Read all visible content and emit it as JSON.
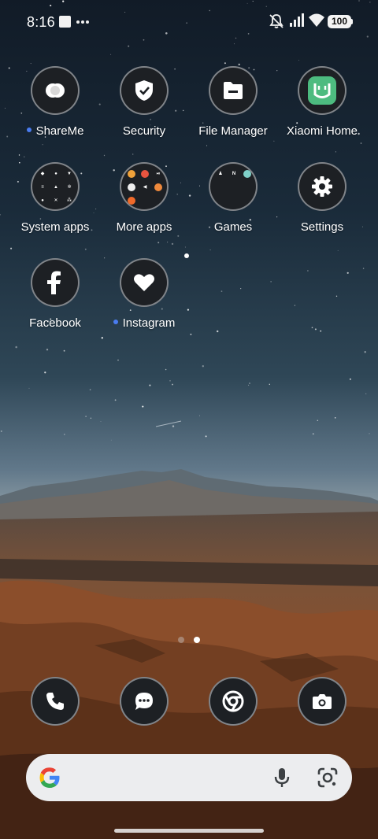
{
  "status_bar": {
    "time": "8:16",
    "battery": "100",
    "icons": [
      "media-square-icon",
      "more-notifications-icon",
      "silent-mode-icon",
      "signal-icon",
      "wifi-icon",
      "battery-icon"
    ]
  },
  "apps": [
    {
      "label": "ShareMe",
      "icon": "shareme-icon",
      "new_dot": true
    },
    {
      "label": "Security",
      "icon": "shield-check-icon",
      "new_dot": false
    },
    {
      "label": "File Manager",
      "icon": "folder-icon",
      "new_dot": false
    },
    {
      "label": "Xiaomi Home",
      "icon": "mi-home-icon",
      "new_dot": false
    },
    {
      "label": "System apps",
      "icon": "folder-system-apps-icon",
      "new_dot": false
    },
    {
      "label": "More apps",
      "icon": "folder-more-apps-icon",
      "new_dot": false
    },
    {
      "label": "Games",
      "icon": "folder-games-icon",
      "new_dot": false
    },
    {
      "label": "Settings",
      "icon": "gear-icon",
      "new_dot": false
    },
    {
      "label": "Facebook",
      "icon": "facebook-icon",
      "new_dot": false
    },
    {
      "label": "Instagram",
      "icon": "heart-icon",
      "new_dot": true
    }
  ],
  "page_indicator": {
    "pages": 2,
    "current": 2
  },
  "dock": [
    {
      "icon": "phone-icon"
    },
    {
      "icon": "messages-icon"
    },
    {
      "icon": "chrome-icon"
    },
    {
      "icon": "camera-icon"
    }
  ],
  "search_bar": {
    "logo": "google-g-icon",
    "voice": "microphone-icon",
    "lens": "google-lens-icon"
  },
  "colors": {
    "icon_bg": "#1d2024",
    "new_dot": "#4a7cf0",
    "search_bg": "#ecedef",
    "mi_home_green": "#4dbb7f"
  }
}
